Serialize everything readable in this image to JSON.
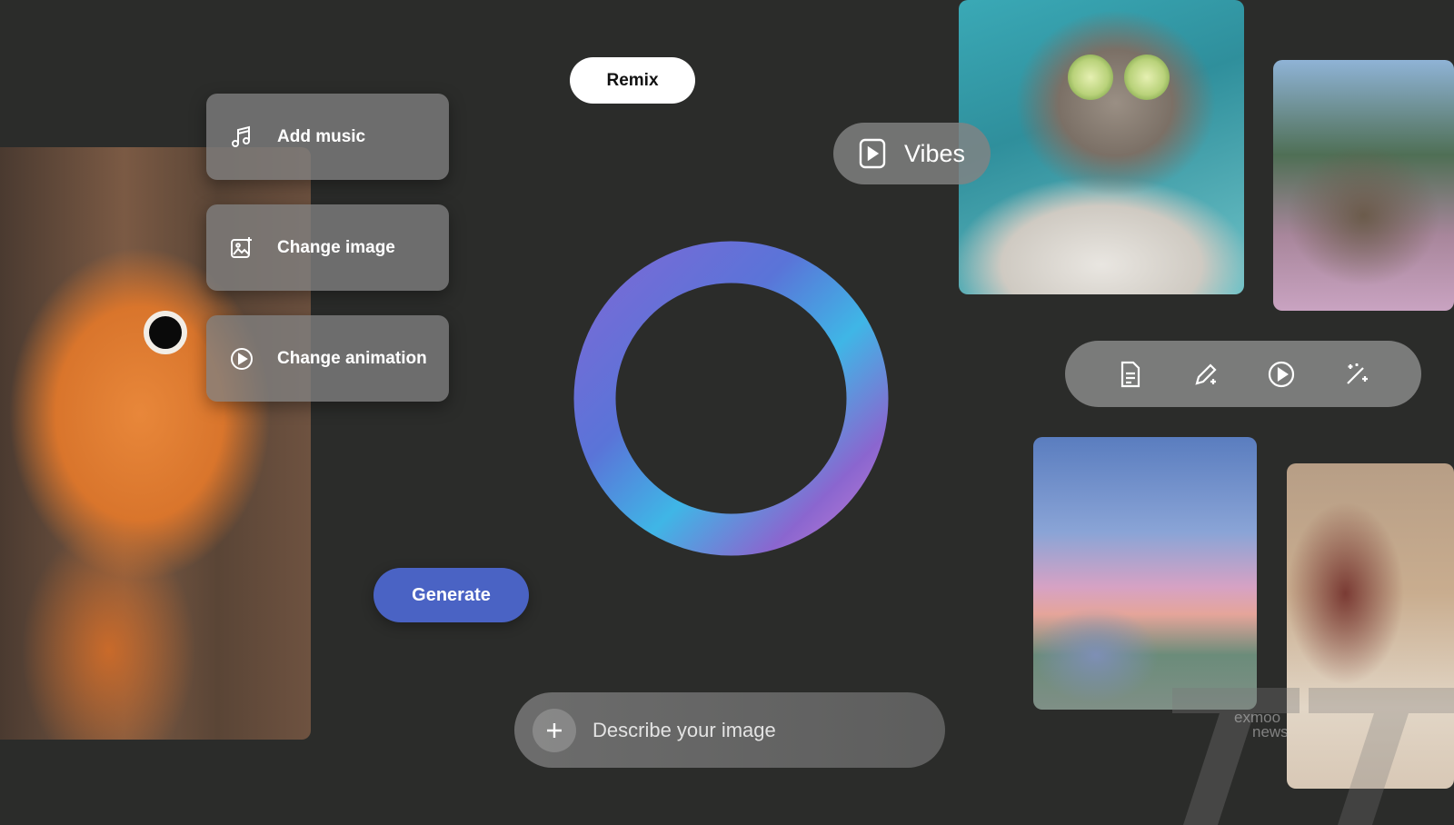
{
  "menu": {
    "items": [
      {
        "label": "Add music",
        "icon": "music-note-icon"
      },
      {
        "label": "Change image",
        "icon": "image-sparkle-icon"
      },
      {
        "label": "Change animation",
        "icon": "play-circle-icon"
      }
    ]
  },
  "remix": {
    "label": "Remix"
  },
  "vibes": {
    "label": "Vibes",
    "icon": "video-play-icon"
  },
  "toolbar": {
    "tools": [
      {
        "icon": "document-icon"
      },
      {
        "icon": "pencil-sparkle-icon"
      },
      {
        "icon": "play-circle-icon"
      },
      {
        "icon": "magic-wand-icon"
      }
    ]
  },
  "generate": {
    "label": "Generate"
  },
  "prompt": {
    "placeholder": "Describe your image",
    "icon": "plus-icon"
  },
  "watermark": {
    "line1": "exmoo",
    "line2": "news"
  },
  "colors": {
    "background": "#2b2c2a",
    "generate": "#4a63c4",
    "ring_start": "#8a5fd0",
    "ring_mid": "#3fb6e6",
    "ring_end": "#b779d6"
  }
}
